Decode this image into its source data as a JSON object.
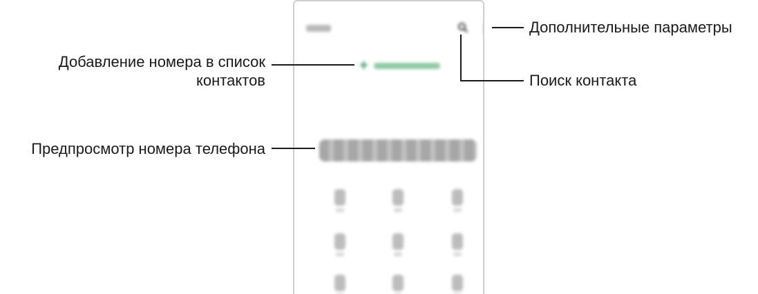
{
  "callouts": {
    "more_options": "Дополнительные параметры",
    "add_to_contacts_line1": "Добавление номера в список",
    "add_to_contacts_line2": "контактов",
    "search_contact": "Поиск контакта",
    "number_preview": "Предпросмотр номера телефона"
  },
  "phone": {
    "icons": [
      "search-icon",
      "more-options-icon",
      "add-plus-icon"
    ],
    "accent_color": "#3b9d63"
  }
}
